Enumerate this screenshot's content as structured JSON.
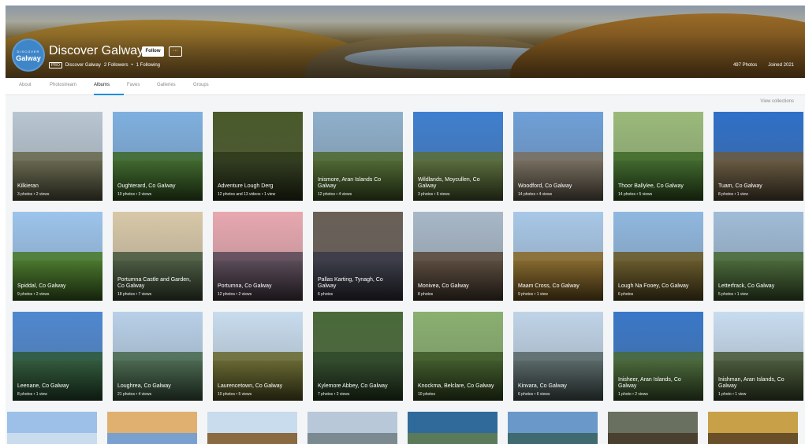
{
  "profile": {
    "avatar_top": "DISCOVER",
    "avatar_main": "Galway",
    "name": "Discover Galway",
    "follow_label": "Follow",
    "more_label": "···",
    "pro_badge": "PRO",
    "handle": "Discover Galway",
    "followers": "2 Followers",
    "following": "1 Following",
    "photo_count": "497 Photos",
    "joined": "Joined 2021"
  },
  "tabs": [
    "About",
    "Photostream",
    "Albums",
    "Faves",
    "Galleries",
    "Groups"
  ],
  "active_tab": "Albums",
  "view_collections": "View collections",
  "albums": [
    {
      "title": "Kilkieran",
      "stats": "3 photos • 2 views",
      "sky": "#b8c6d2",
      "ground": "#6a6a50"
    },
    {
      "title": "Oughterard, Co Galway",
      "stats": "10 photos • 3 views",
      "sky": "#7fb0e0",
      "ground": "#3f6a2a"
    },
    {
      "title": "Adventure Lough Derg",
      "stats": "12 photos and 13 videos • 1 view",
      "sky": "#4a5a2a",
      "ground": "#2f3a1c"
    },
    {
      "title": "Inismore, Aran Islands Co Galway",
      "stats": "12 photos • 4 views",
      "sky": "#8fb0cc",
      "ground": "#4f6a30"
    },
    {
      "title": "Wildlands, Moycullen, Co Galway",
      "stats": "3 photos • 6 views",
      "sky": "#3f7fd0",
      "ground": "#5a6e3a"
    },
    {
      "title": "Woodford, Co Galway",
      "stats": "14 photos • 4 views",
      "sky": "#6fa0d8",
      "ground": "#7a7060"
    },
    {
      "title": "Thoor Ballylee, Co Galway",
      "stats": "14 photos • 5 views",
      "sky": "#9aba7a",
      "ground": "#3f6a2a"
    },
    {
      "title": "Tuam, Co Galway",
      "stats": "8 photos • 1 view",
      "sky": "#2f70c8",
      "ground": "#6a5a40"
    },
    {
      "title": "Spiddal, Co Galway",
      "stats": "9 photos • 2 views",
      "sky": "#9cc4ec",
      "ground": "#4a7a2a"
    },
    {
      "title": "Portumna Castle and Garden, Co Galway",
      "stats": "18 photos • 7 views",
      "sky": "#d8c8a8",
      "ground": "#4a5a40"
    },
    {
      "title": "Portumna, Co Galway",
      "stats": "12 photos • 2 views",
      "sky": "#e8a8b0",
      "ground": "#5a4a58"
    },
    {
      "title": "Pallas Karting, Tynagh, Co Galway",
      "stats": "6 photos",
      "sky": "#6a6058",
      "ground": "#3a3a48"
    },
    {
      "title": "Monivea, Co Galway",
      "stats": "8 photos",
      "sky": "#a8b8c8",
      "ground": "#5a4a3c"
    },
    {
      "title": "Maam Cross, Co Galway",
      "stats": "9 photos • 1 view",
      "sky": "#a8c8e8",
      "ground": "#8a6a2a"
    },
    {
      "title": "Lough Na Fooey, Co Galway",
      "stats": "6 photos",
      "sky": "#90b8e0",
      "ground": "#6a5a28"
    },
    {
      "title": "Letterfrack, Co Galway",
      "stats": "5 photos • 1 view",
      "sky": "#a0bcd8",
      "ground": "#4a6a38"
    },
    {
      "title": "Leenane, Co Galway",
      "stats": "8 photos • 1 view",
      "sky": "#4f88d0",
      "ground": "#2f5a3a"
    },
    {
      "title": "Loughrea, Co Galway",
      "stats": "21 photos • 4 views",
      "sky": "#b8d0e8",
      "ground": "#4a6a50"
    },
    {
      "title": "Laurencetown, Co Galway",
      "stats": "10 photos • 5 views",
      "sky": "#c8dcee",
      "ground": "#6a6a30"
    },
    {
      "title": "Kylemore Abbey, Co Galway",
      "stats": "7 photos • 2 views",
      "sky": "#4a6a3a",
      "ground": "#2f4a2a"
    },
    {
      "title": "Knockma, Belclare, Co Galway",
      "stats": "10 photos",
      "sky": "#8ab070",
      "ground": "#3f5a28"
    },
    {
      "title": "Kinvara, Co Galway",
      "stats": "6 photos • 6 views",
      "sky": "#c0d4e8",
      "ground": "#5a6a6a"
    },
    {
      "title": "Inisheer, Aran Islands, Co Galway",
      "stats": "1 photo • 2 views",
      "sky": "#3a78c8",
      "ground": "#4a6a38"
    },
    {
      "title": "Inishman, Aran Islands, Co Galway",
      "stats": "1 photo • 1 view",
      "sky": "#c8dcf0",
      "ground": "#4a5a38"
    }
  ],
  "partial_row": [
    {
      "sky": "#9cc0e8",
      "ground": "#c8dcee"
    },
    {
      "sky": "#e0b070",
      "ground": "#7aa0d0"
    },
    {
      "sky": "#c8dcee",
      "ground": "#8a6a40"
    },
    {
      "sky": "#b8c8d8",
      "ground": "#7a8a90"
    },
    {
      "sky": "#2f6a9a",
      "ground": "#5a7a5a"
    },
    {
      "sky": "#6a98c8",
      "ground": "#3f6a70"
    },
    {
      "sky": "#6a7060",
      "ground": "#4a4030"
    },
    {
      "sky": "#c8a048",
      "ground": "#6a5028"
    }
  ]
}
